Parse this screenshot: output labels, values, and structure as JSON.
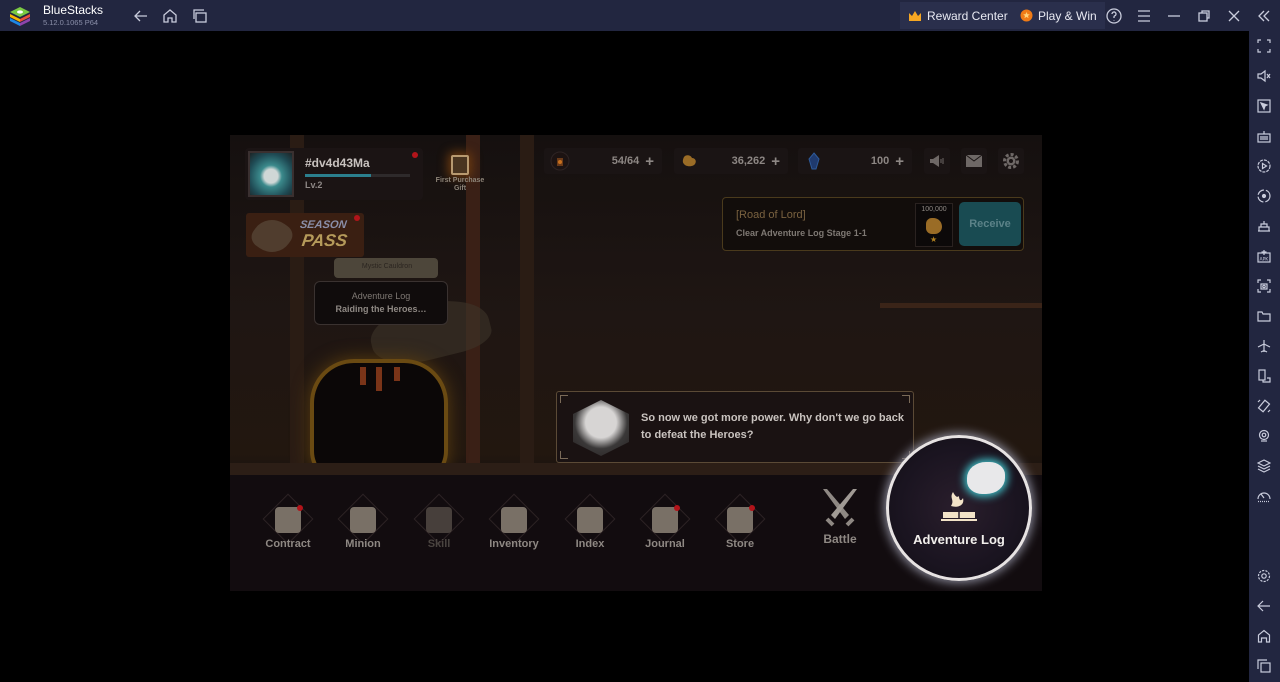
{
  "titlebar": {
    "app_name": "BlueStacks",
    "version": "5.12.0.1065  P64",
    "reward_center": "Reward Center",
    "play_win": "Play & Win"
  },
  "sidebar": {
    "top_icons": [
      "fullscreen-icon",
      "volume-mute-icon",
      "cursor-icon",
      "keyboard-icon",
      "macro-play-icon",
      "sync-icon",
      "build-icon",
      "install-apk-icon",
      "screenshot-icon",
      "folder-icon",
      "airplane-mode-icon",
      "rotate-screen-icon",
      "shake-icon",
      "location-icon",
      "layers-icon",
      "eco-mode-icon"
    ],
    "bottom_icons": [
      "settings-icon",
      "back-icon",
      "home-icon",
      "recent-apps-icon"
    ]
  },
  "game": {
    "player": {
      "name": "#dv4d43Ma",
      "level": "Lv.2",
      "xp_fraction": 0.63
    },
    "first_purchase_gift": "First Purchase Gift",
    "resources": {
      "stamina": "54/64",
      "gold": "36,262",
      "gems": "100"
    },
    "season_pass": {
      "line1": "SEASON",
      "line2": "PASS"
    },
    "mystic_cauldron": {
      "banner": "Mystic Cauldron",
      "title": "Adventure Log",
      "subtitle": "Raiding the Heroes…"
    },
    "quest": {
      "title": "[Road of Lord]",
      "description": "Clear Adventure Log Stage 1-1",
      "reward_amount": "100,000",
      "receive": "Receive"
    },
    "dialog": {
      "text": "So now we got more power. Why don't we go back to defeat the Heroes?"
    },
    "nav": [
      {
        "label": "Contract",
        "badge": true,
        "locked": false
      },
      {
        "label": "Minion",
        "badge": false,
        "locked": false
      },
      {
        "label": "Skill",
        "badge": false,
        "locked": true
      },
      {
        "label": "Inventory",
        "badge": false,
        "locked": false
      },
      {
        "label": "Index",
        "badge": false,
        "locked": false
      },
      {
        "label": "Journal",
        "badge": true,
        "locked": false
      },
      {
        "label": "Store",
        "badge": true,
        "locked": false
      }
    ],
    "battle": "Battle",
    "adventure_log": "Adventure Log"
  }
}
